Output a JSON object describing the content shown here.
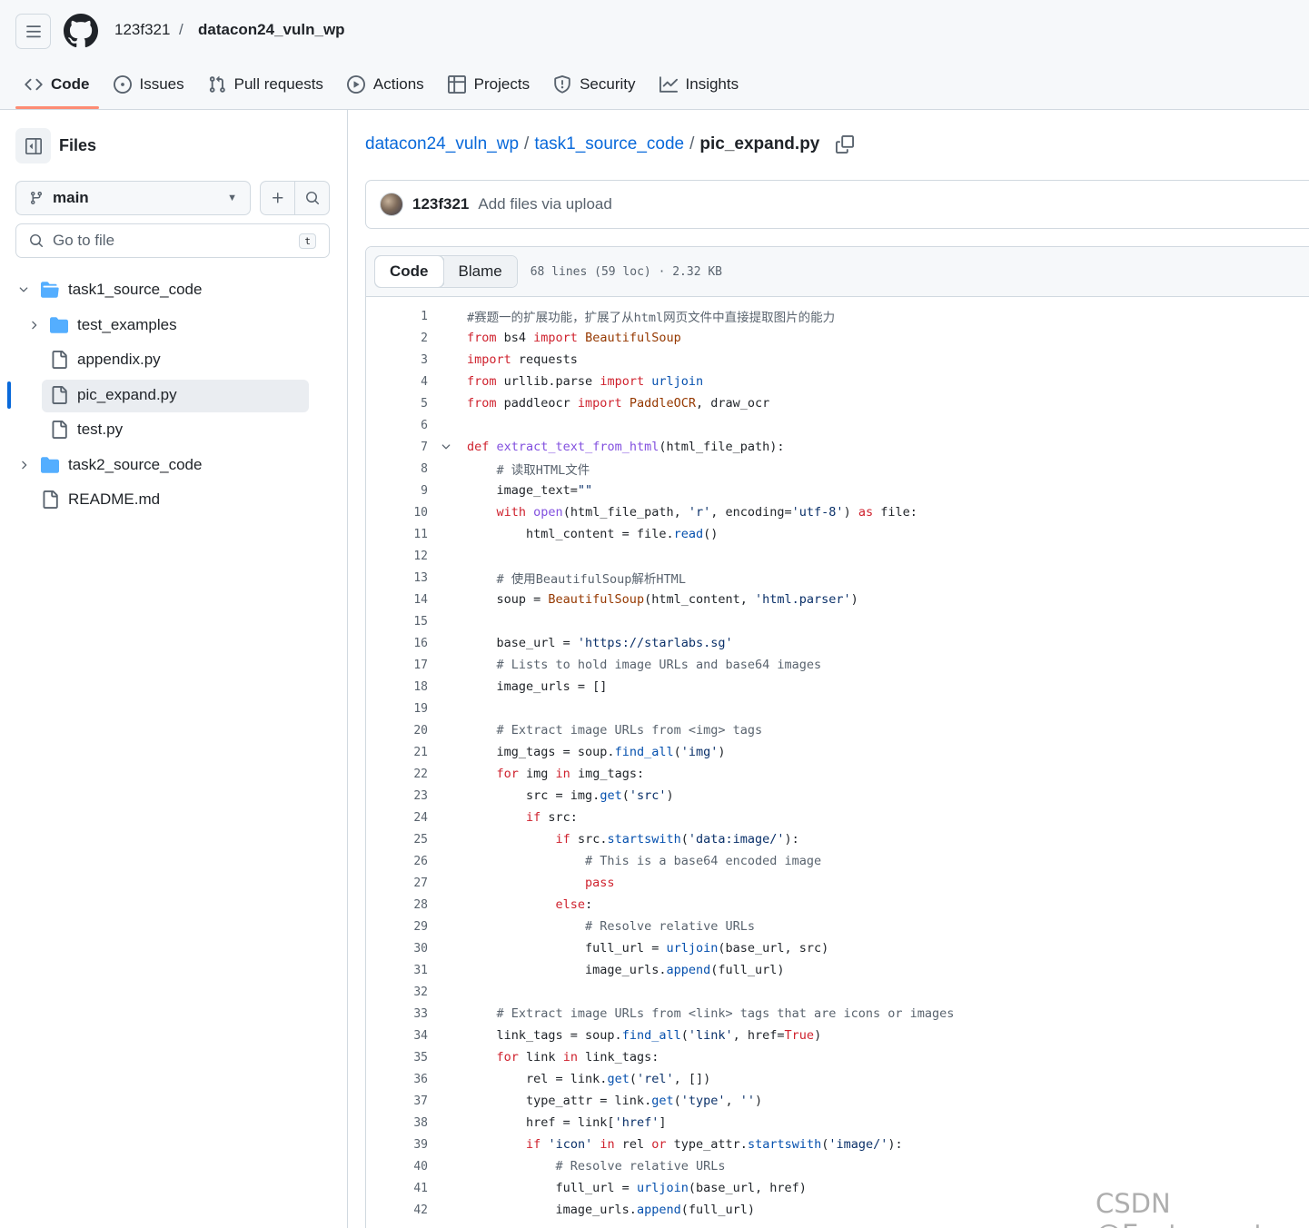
{
  "header": {
    "owner": "123f321",
    "separator": "/",
    "repo": "datacon24_vuln_wp"
  },
  "nav": [
    {
      "label": "Code",
      "icon": "code-icon",
      "active": true
    },
    {
      "label": "Issues",
      "icon": "issue-icon"
    },
    {
      "label": "Pull requests",
      "icon": "pull-request-icon"
    },
    {
      "label": "Actions",
      "icon": "play-icon"
    },
    {
      "label": "Projects",
      "icon": "table-icon"
    },
    {
      "label": "Security",
      "icon": "shield-icon"
    },
    {
      "label": "Insights",
      "icon": "graph-icon"
    }
  ],
  "sidebar": {
    "title": "Files",
    "branch": "main",
    "goto_placeholder": "Go to file",
    "goto_shortcut": "t",
    "tree": [
      {
        "label": "task1_source_code",
        "type": "folder",
        "depth": 0,
        "expanded": true
      },
      {
        "label": "test_examples",
        "type": "folder",
        "depth": 1,
        "expanded": false
      },
      {
        "label": "appendix.py",
        "type": "file",
        "depth": 1
      },
      {
        "label": "pic_expand.py",
        "type": "file",
        "depth": 1,
        "selected": true
      },
      {
        "label": "test.py",
        "type": "file",
        "depth": 1
      },
      {
        "label": "task2_source_code",
        "type": "folder",
        "depth": 0,
        "expanded": false
      },
      {
        "label": "README.md",
        "type": "file",
        "depth": 0
      }
    ]
  },
  "breadcrumb": {
    "repo": "datacon24_vuln_wp",
    "folder": "task1_source_code",
    "file": "pic_expand.py",
    "sep": "/"
  },
  "commit": {
    "author": "123f321",
    "message": "Add files via upload"
  },
  "code_view": {
    "tab_code": "Code",
    "tab_blame": "Blame",
    "meta": "68 lines (59 loc) · 2.32 KB"
  },
  "code": [
    "#赛题一的扩展功能，扩展了从html网页文件中直接提取图片的能力",
    "from bs4 import BeautifulSoup",
    "import requests",
    "from urllib.parse import urljoin",
    "from paddleocr import PaddleOCR, draw_ocr",
    "",
    "def extract_text_from_html(html_file_path):",
    "    # 读取HTML文件",
    "    image_text=\"\"",
    "    with open(html_file_path, 'r', encoding='utf-8') as file:",
    "        html_content = file.read()",
    "",
    "    # 使用BeautifulSoup解析HTML",
    "    soup = BeautifulSoup(html_content, 'html.parser')",
    "",
    "    base_url = 'https://starlabs.sg'",
    "    # Lists to hold image URLs and base64 images",
    "    image_urls = []",
    "",
    "    # Extract image URLs from <img> tags",
    "    img_tags = soup.find_all('img')",
    "    for img in img_tags:",
    "        src = img.get('src')",
    "        if src:",
    "            if src.startswith('data:image/'):",
    "                # This is a base64 encoded image",
    "                pass",
    "            else:",
    "                # Resolve relative URLs",
    "                full_url = urljoin(base_url, src)",
    "                image_urls.append(full_url)",
    "",
    "    # Extract image URLs from <link> tags that are icons or images",
    "    link_tags = soup.find_all('link', href=True)",
    "    for link in link_tags:",
    "        rel = link.get('rel', [])",
    "        type_attr = link.get('type', '')",
    "        href = link['href']",
    "        if 'icon' in rel or type_attr.startswith('image/'):",
    "            # Resolve relative URLs",
    "            full_url = urljoin(base_url, href)",
    "            image_urls.append(full_url)"
  ],
  "watermark": "CSDN @Eastmount",
  "colors": {
    "accent": "#0969da",
    "nav_underline": "#fd8c73",
    "keyword": "#cf222e",
    "function": "#8250df",
    "string": "#0a3069",
    "comment": "#59636e"
  }
}
